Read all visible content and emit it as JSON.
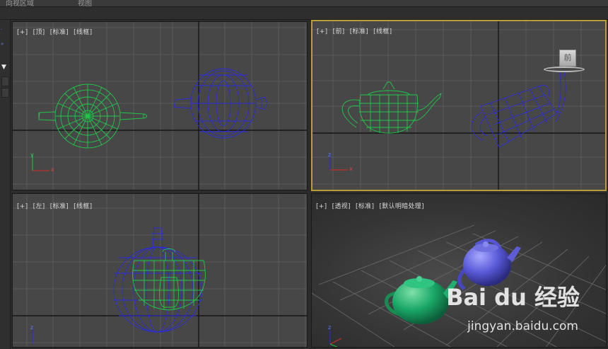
{
  "menubar": {
    "text_left": "向视区域",
    "text_right": "视图"
  },
  "viewports": {
    "top": {
      "plus": "[+]",
      "view": "[顶]",
      "shading_std": "[标准]",
      "mode": "[线框]"
    },
    "front": {
      "plus": "[+]",
      "view": "[前]",
      "shading_std": "[标准]",
      "mode": "[线框]",
      "viewcube_label": "前"
    },
    "left": {
      "plus": "[+]",
      "view": "[左]",
      "shading_std": "[标准]",
      "mode": "[线框]"
    },
    "perspective": {
      "plus": "[+]",
      "view": "[透视]",
      "shading_std": "[标准]",
      "mode": "[默认明暗处理]"
    }
  },
  "axes": {
    "x": "x",
    "y": "y",
    "z": "z"
  },
  "watermark": {
    "logo": "Bai du 经验",
    "url": "jingyan.baidu.com"
  },
  "colors": {
    "teapot_green": "#1fc94a",
    "teapot_blue": "#2b2bd9",
    "active_border": "#b79d3c",
    "grid_major": "#1a1a1a",
    "grid_minor": "#5a5a5a"
  }
}
